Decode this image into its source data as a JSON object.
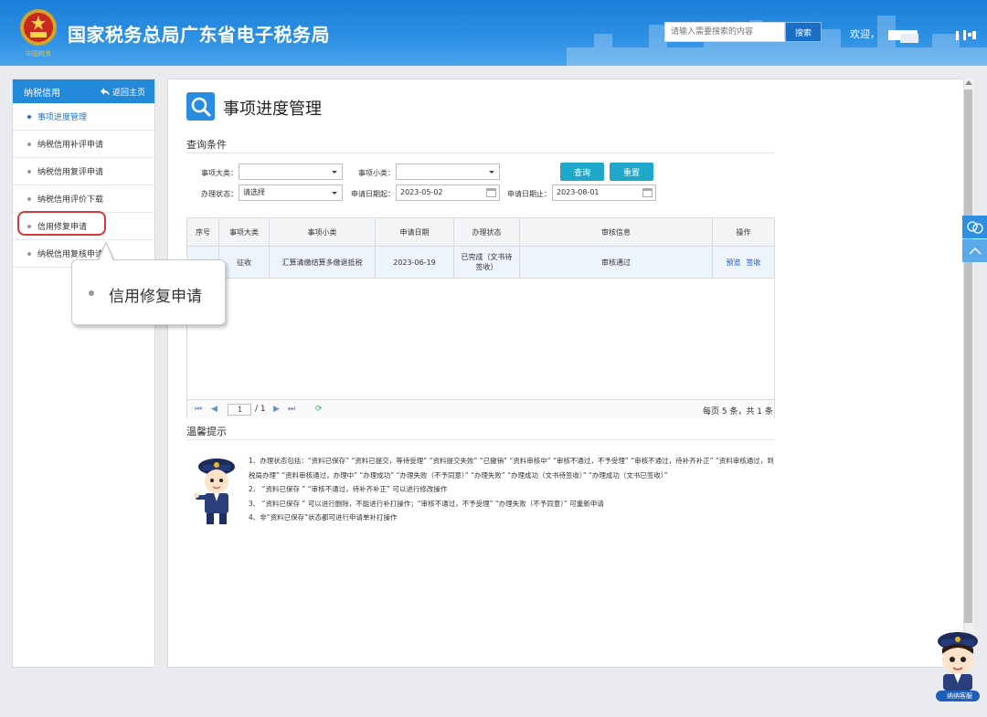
{
  "header": {
    "site_title": "国家税务总局广东省电子税务局",
    "emblem_caption": "中国税务",
    "search_placeholder": "请输入需要搜索的内容",
    "search_button": "搜索",
    "welcome": "欢迎，"
  },
  "sidebar": {
    "title": "纳税信用",
    "back": "返回主页",
    "items": [
      {
        "label": "事项进度管理",
        "active": true
      },
      {
        "label": "纳税信用补评申请",
        "active": false
      },
      {
        "label": "纳税信用复评申请",
        "active": false
      },
      {
        "label": "纳税信用评价下载",
        "active": false
      },
      {
        "label": "信用修复申请",
        "active": false
      },
      {
        "label": "纳税信用复核申请",
        "active": false
      }
    ]
  },
  "callout": {
    "text": "信用修复申请"
  },
  "main": {
    "page_title": "事项进度管理",
    "query_section": "查询条件",
    "filters": {
      "category_label": "事项大类：",
      "category_value": "",
      "subcategory_label": "事项小类：",
      "subcategory_value": "",
      "status_label": "办理状态：",
      "status_value": "请选择",
      "date_start_label": "申请日期起：",
      "date_start_value": "2023-05-02",
      "date_end_label": "申请日期止：",
      "date_end_value": "2023-08-01"
    },
    "buttons": {
      "query": "查询",
      "reset": "重置"
    },
    "table": {
      "headers": [
        "序号",
        "事项大类",
        "事项小类",
        "申请日期",
        "办理状态",
        "审核信息",
        "操作"
      ],
      "rows": [
        {
          "index": "1",
          "category": "征收",
          "subcategory": "汇算清缴结算多缴退抵税",
          "date": "2023-06-19",
          "status": "已完成（文书待签收）",
          "review": "审核通过",
          "action_preview": "预览",
          "action_sign": "签收"
        }
      ]
    },
    "pager": {
      "page": "1",
      "total_pages": "/ 1",
      "summary": "每页 5 条，共 1 条"
    },
    "tips_section": "温馨提示",
    "tips": [
      "1、办理状态包括：“资料已保存” “资料已提交，等待受理” “资料提交失败” “已撤销” “资料审核中” “审核不通过，不予受理” “审核不通过，待补齐补正” “资料审核通过，到税局办理” “资料审核通过，办理中” “办理成功” “办理失败（不予同意）” “办理失败” “办理成功（文书待签收）” “办理成功（文书已签收）”",
      "2、 “资料已保存 ” “审核不通过，待补齐补正” 可以进行修改操作",
      "3、 “资料已保存 ” 可以进行删除，不能进行补打操作；“审核不通过，不予受理” “办理失败（不予同意）” 可重新申请",
      "4、非“资料已保存”状态都可进行申请单补打操作"
    ]
  },
  "assistant": {
    "label": "纳纳客服"
  },
  "colors": {
    "header": "#1b7fd9",
    "accent": "#2288d8",
    "button": "#1fa8c9",
    "highlight": "#d9363a"
  }
}
